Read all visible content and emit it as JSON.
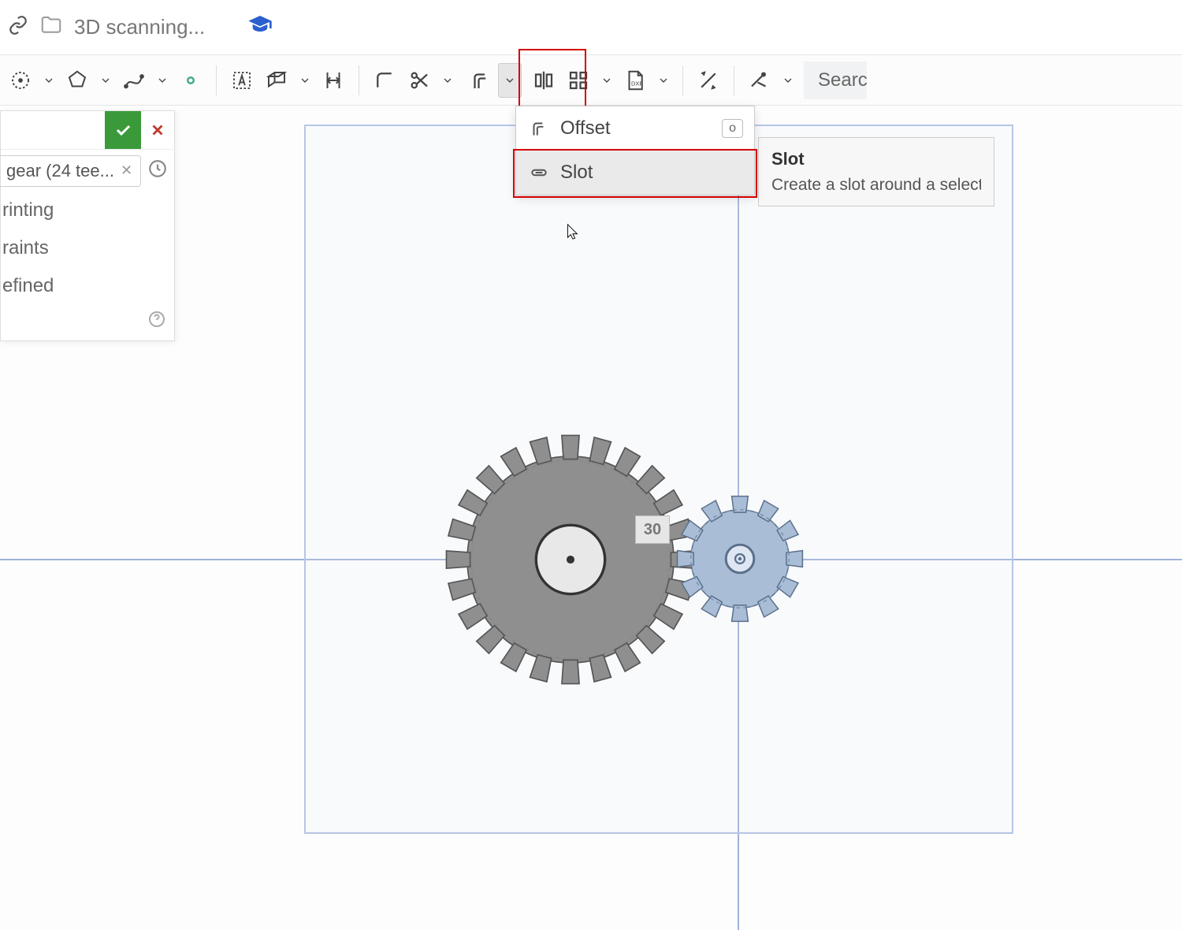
{
  "breadcrumb": {
    "folder": "3D scanning..."
  },
  "toolbar": {
    "search_placeholder": "Search"
  },
  "dropdown": {
    "items": [
      {
        "label": "Offset",
        "shortcut": "o"
      },
      {
        "label": "Slot",
        "shortcut": ""
      }
    ]
  },
  "tooltip": {
    "title": "Slot",
    "description": "Create a slot around a selecte"
  },
  "panel": {
    "chip": "gear (24 tee...",
    "options": [
      "rinting",
      "raints",
      "efined"
    ]
  },
  "canvas": {
    "dimension": "30"
  }
}
